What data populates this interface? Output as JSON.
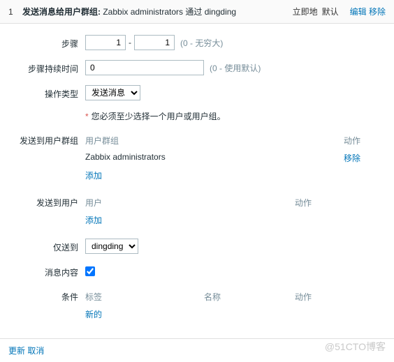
{
  "header": {
    "num": "1",
    "desc_prefix": "发送消息给用户群组: ",
    "desc_value": "Zabbix administrators 通过 dingding",
    "timing_immediate": "立即地",
    "timing_default": "默认",
    "edit": "编辑",
    "remove": "移除"
  },
  "form": {
    "steps_label": "步骤",
    "steps_from": "1",
    "steps_to": "1",
    "steps_hint": "(0 - 无穷大)",
    "duration_label": "步骤持续时间",
    "duration_value": "0",
    "duration_hint": "(0 - 使用默认)",
    "optype_label": "操作类型",
    "optype_value": "发送消息",
    "required_msg": "您必须至少选择一个用户或用户组。",
    "groups_label": "发送到用户群组",
    "groups_col1": "用户群组",
    "groups_col_action": "动作",
    "groups_row1": "Zabbix administrators",
    "groups_row1_action": "移除",
    "add": "添加",
    "users_label": "发送到用户",
    "users_col1": "用户",
    "users_col_action": "动作",
    "sendonly_label": "仅送到",
    "sendonly_value": "dingding",
    "msgcontent_label": "消息内容",
    "conditions_label": "条件",
    "conditions_col1": "标签",
    "conditions_col2": "名称",
    "conditions_col3": "动作",
    "new": "新的"
  },
  "footer": {
    "update": "更新",
    "cancel": "取消"
  },
  "watermark": "@51CTO博客"
}
